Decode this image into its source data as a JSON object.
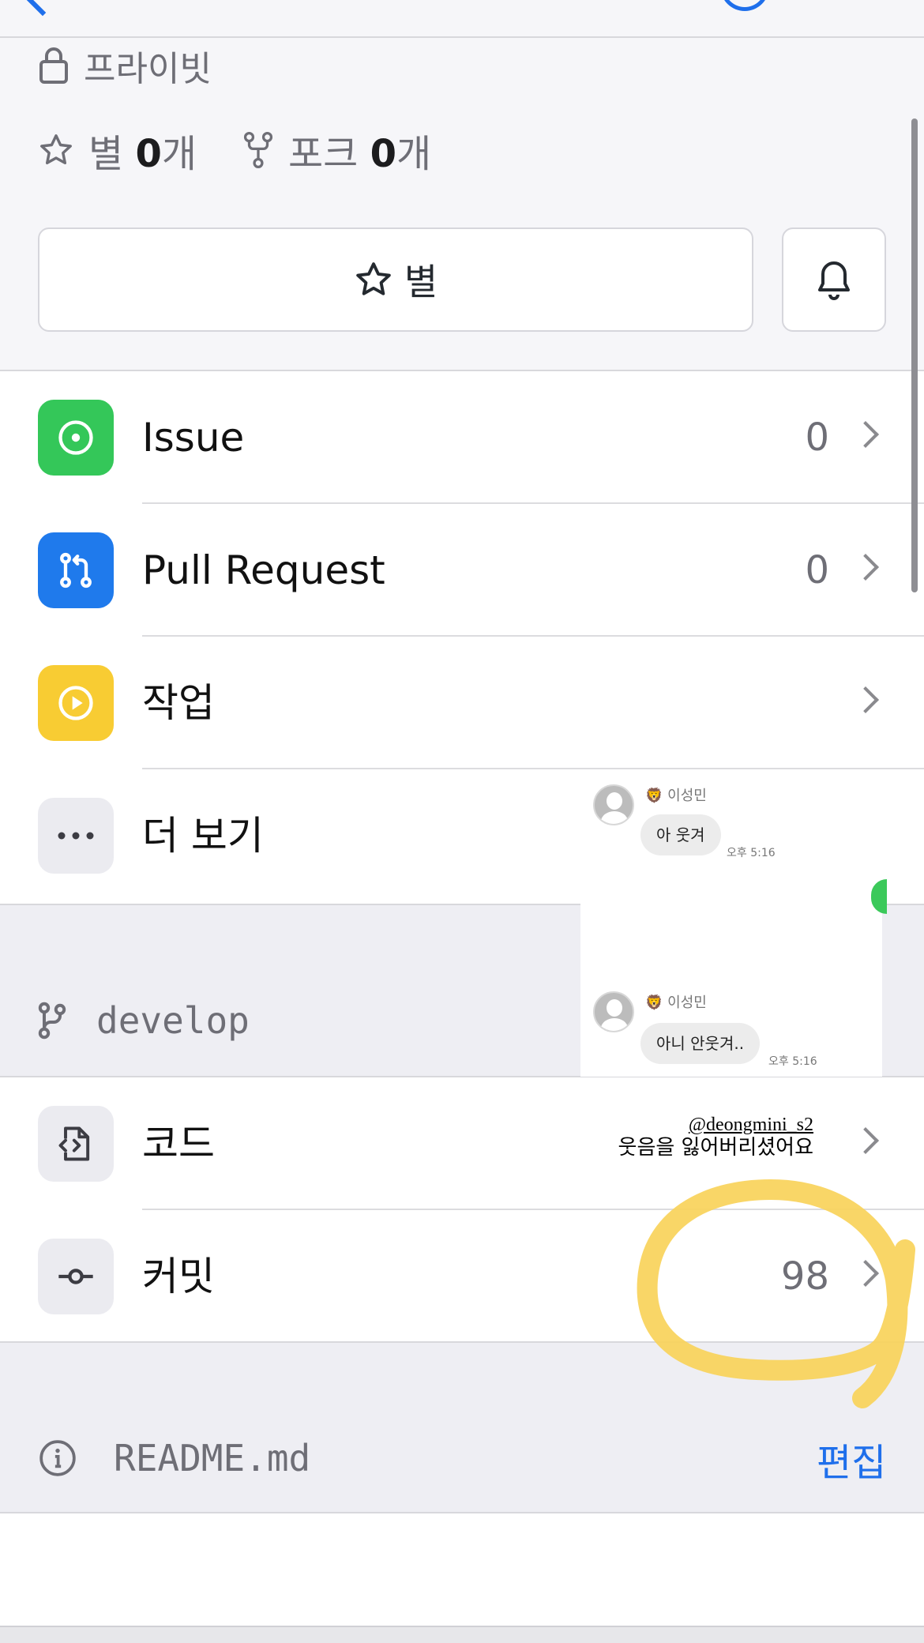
{
  "header": {
    "visibility": "프라이빗",
    "stars_label": "별",
    "stars_count": "0",
    "stars_suffix": "개",
    "forks_label": "포크",
    "forks_count": "0",
    "forks_suffix": "개",
    "star_button_label": "별"
  },
  "list": {
    "issue": {
      "label": "Issue",
      "count": "0",
      "color": "#34c759"
    },
    "pull_request": {
      "label": "Pull Request",
      "count": "0",
      "color": "#1f7aec"
    },
    "actions": {
      "label": "작업",
      "color": "#f8cc33"
    },
    "more": {
      "label": "더 보기"
    }
  },
  "branch": {
    "name": "develop"
  },
  "code_section": {
    "code": {
      "label": "코드"
    },
    "commits": {
      "label": "커밋",
      "count": "98"
    }
  },
  "readme": {
    "filename": "README.md",
    "edit_label": "편집"
  },
  "chat_overlay": {
    "messages": [
      {
        "sender": "🦁 이성민",
        "text": "아 웃겨",
        "time": "오후 5:16"
      },
      {
        "sender": "🦁 이성민",
        "text": "아니 안웃겨..",
        "time": "오후 5:16"
      }
    ]
  },
  "watermark": {
    "handle": "@deongmini_s2",
    "caption": "웃음을 잃어버리셨어요"
  },
  "colors": {
    "accent": "#1f6feb",
    "highlight": "#f9d35a"
  }
}
